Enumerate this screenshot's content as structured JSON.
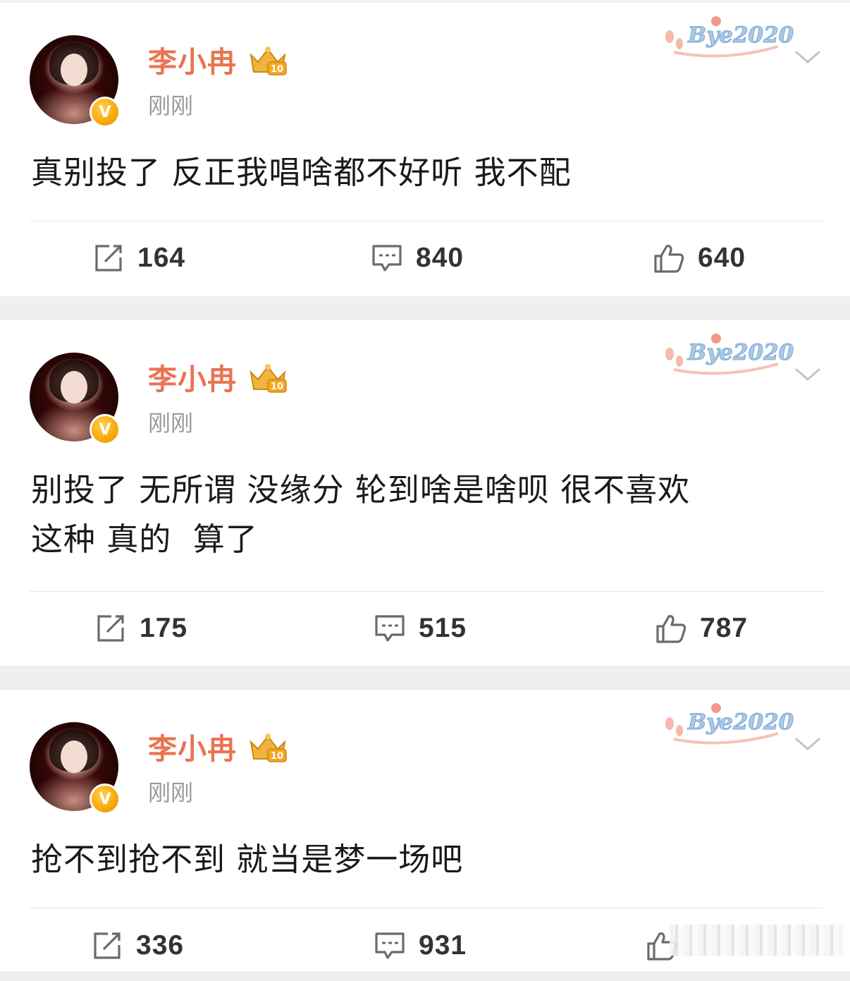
{
  "posts": [
    {
      "username": "李小冉",
      "timestamp": "刚刚",
      "content": "真别投了 反正我唱啥都不好听 我不配",
      "sticker_text": "Bye2020",
      "reposts": "164",
      "comments": "840",
      "likes": "640"
    },
    {
      "username": "李小冉",
      "timestamp": "刚刚",
      "content": "别投了 无所谓 没缘分 轮到啥是啥呗 很不喜欢\n这种 真的  算了",
      "sticker_text": "Bye2020",
      "reposts": "175",
      "comments": "515",
      "likes": "787"
    },
    {
      "username": "李小冉",
      "timestamp": "刚刚",
      "content": "抢不到抢不到 就当是梦一场吧",
      "sticker_text": "Bye2020",
      "reposts": "336",
      "comments": "931",
      "likes": ""
    }
  ],
  "icons": {
    "verified": "verified-v-badge-icon",
    "vip": "vip-crown-level-10-icon",
    "more": "chevron-down-icon",
    "repost": "repost-icon",
    "comment": "comment-icon",
    "like": "thumbs-up-icon"
  },
  "colors": {
    "username": "#eb7350",
    "timestamp": "#9a9a9a",
    "verified_badge": "#f5a100",
    "separator": "#efeff1"
  }
}
